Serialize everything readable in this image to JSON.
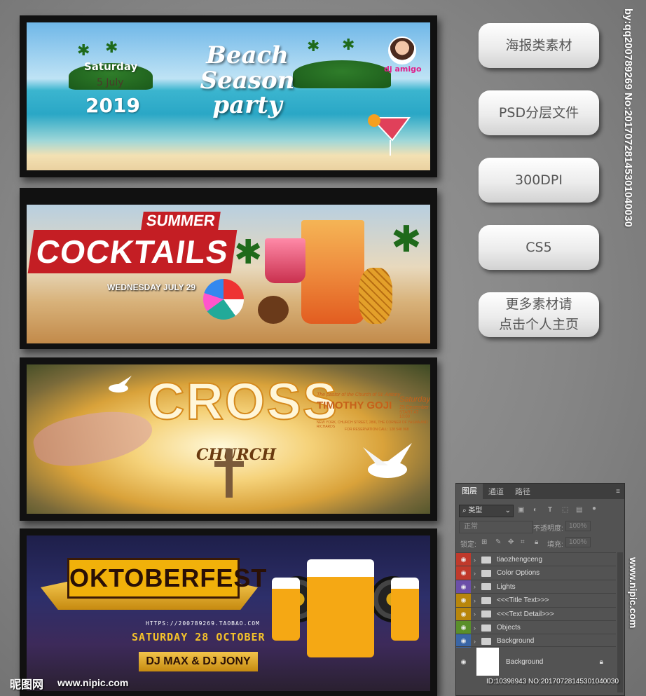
{
  "banner1": {
    "day": "Saturday",
    "date": "5 July",
    "year": "2019",
    "title_lines": [
      "Beach",
      "Season",
      "party"
    ],
    "dj": "dj amigo"
  },
  "banner2": {
    "summer": "SUMMER",
    "title": "COCKTAILS",
    "date": "WEDNESDAY JULY 29"
  },
  "banner3": {
    "title": "CROSS",
    "subtitle": "CHURCH",
    "pastor_line": "The pastor of the Church of St. Antony",
    "name": "TIMOTHY GOJI",
    "day": "Saturday",
    "date": "25 December",
    "time": "START AT 10:00",
    "address": "NEW YORK, CHURCH STREET, 28/6, THE CORNER OF YASMA AND RICHARDS",
    "reservation": "FOR RESERVATION CALL: 128 548 968"
  },
  "banner4": {
    "title": "OKTOBERFEST",
    "url": "HTTPS://200789269.TAOBAO.COM",
    "date": "SATURDAY 28 OCTOBER",
    "djs": "DJ MAX & DJ JONY"
  },
  "pills": [
    "海报类素材",
    "PSD分层文件",
    "300DPI",
    "CS5",
    "更多素材请\n点击个人主页"
  ],
  "side_watermark": "by:qq200789269 No:20170728145301040030",
  "side_watermark2": "www.nipic.com",
  "layers_panel": {
    "tabs": [
      "图层",
      "通道",
      "路径"
    ],
    "filter_label": "类型",
    "blend_mode": "正常",
    "opacity_label": "不透明度:",
    "opacity_value": "100%",
    "lock_label": "锁定:",
    "fill_label": "填充:",
    "fill_value": "100%",
    "layers": [
      {
        "name": "tiaozhengceng",
        "color": "#c0392b"
      },
      {
        "name": "Color Options",
        "color": "#c0392b"
      },
      {
        "name": "Lights",
        "color": "#6b4fa8"
      },
      {
        "name": "<<<Title Text>>>",
        "color": "#b8860b"
      },
      {
        "name": "<<<Text Detail>>>",
        "color": "#b8860b"
      },
      {
        "name": "Objects",
        "color": "#5a8f2a"
      },
      {
        "name": "Background",
        "color": "#3a66a6"
      }
    ],
    "bg_layer": "Background"
  },
  "footer": {
    "logo": "昵图网",
    "url": "www.nipic.com",
    "id_line": "ID:10398943 NO:20170728145301040030"
  }
}
